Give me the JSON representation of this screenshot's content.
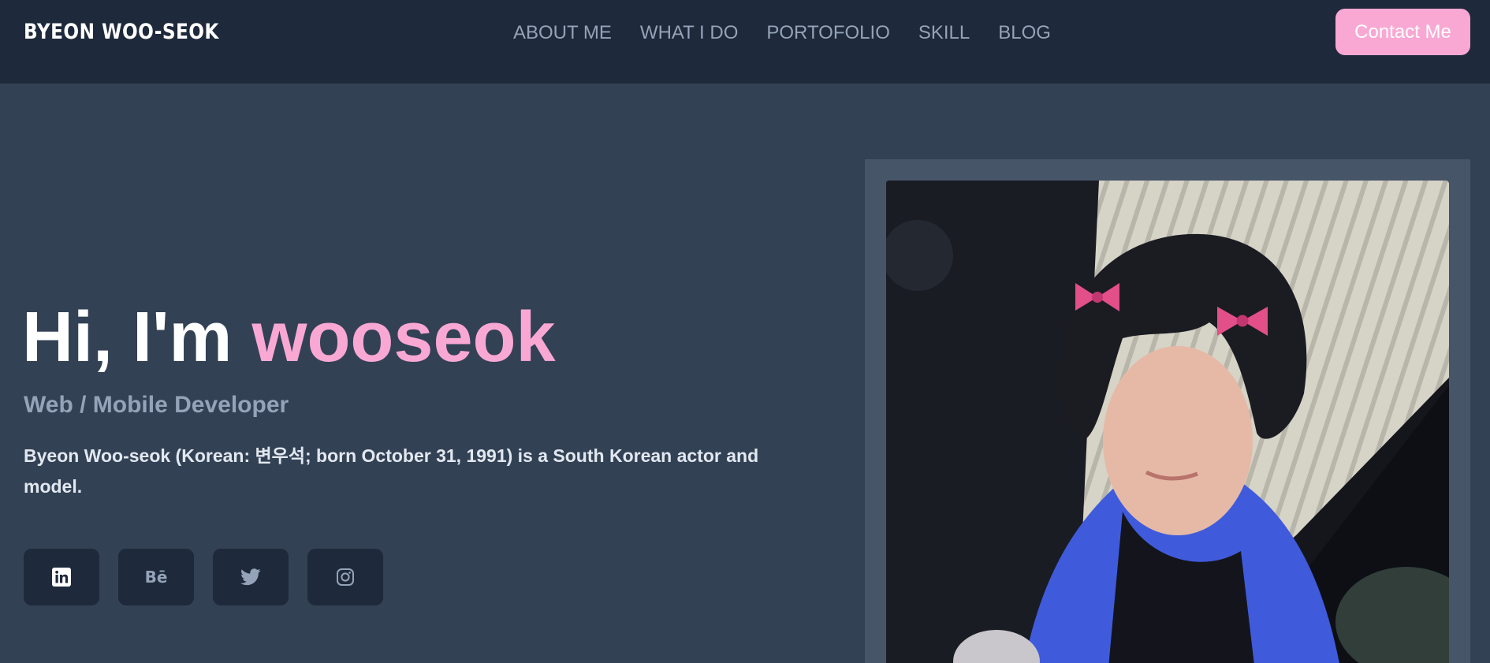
{
  "header": {
    "brand": "BYEON WOO-SEOK",
    "nav": [
      "ABOUT ME",
      "WHAT I DO",
      "PORTOFOLIO",
      "SKILL",
      "BLOG"
    ],
    "contact_label": "Contact Me"
  },
  "hero": {
    "greeting": "Hi, I'm ",
    "name": "wooseok",
    "subtitle": "Web / Mobile Developer",
    "bio": "Byeon Woo-seok (Korean: 변우석; born October 31, 1991) is a South Korean actor and model."
  },
  "socials": [
    {
      "icon": "linkedin-icon"
    },
    {
      "icon": "behance-icon",
      "text": "Bē"
    },
    {
      "icon": "twitter-icon"
    },
    {
      "icon": "instagram-icon"
    }
  ],
  "colors": {
    "navbar": "#1e293b",
    "background": "#334155",
    "accent": "#f9a8d4",
    "muted": "#94a3b8",
    "frame": "#475569"
  }
}
